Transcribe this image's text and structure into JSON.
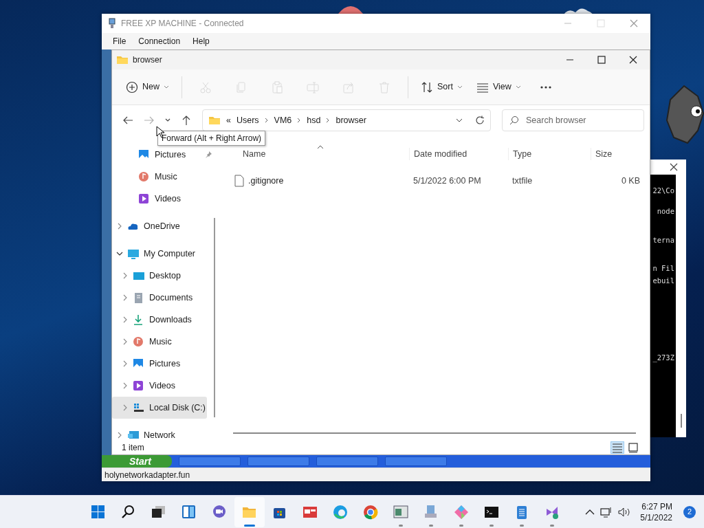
{
  "remote_window": {
    "title": "FREE XP MACHINE - Connected",
    "menu": [
      "File",
      "Connection",
      "Help"
    ],
    "status_bar": "holynetworkadapter.fun"
  },
  "xp_taskbar": {
    "start_label": "Start"
  },
  "host_console": {
    "lines": [
      "22\\Co",
      "node",
      "terna",
      "n Fil",
      "ebuil",
      "_273Z"
    ]
  },
  "explorer": {
    "title": "browser",
    "toolbar": [
      {
        "label": "New",
        "dropdown": true,
        "disabled": false
      },
      {
        "disabled": true
      },
      {
        "disabled": true
      },
      {
        "disabled": true
      },
      {
        "disabled": true
      },
      {
        "disabled": true
      },
      {
        "disabled": true
      },
      {
        "label": "Sort",
        "dropdown": true,
        "disabled": false
      },
      {
        "label": "View",
        "dropdown": true,
        "disabled": false
      },
      {
        "disabled": false
      }
    ],
    "navigation": [
      {
        "disabled": false
      },
      {
        "disabled": true
      },
      {
        "disabled": false
      },
      {
        "disabled": false
      }
    ],
    "address": {
      "overflow": "«",
      "breadcrumbs": [
        "Users",
        "VM6",
        "hsd",
        "browser"
      ]
    },
    "search": {
      "placeholder": "Search browser"
    },
    "tooltip": "Forward (Alt + Right Arrow)",
    "quick_access": [
      {
        "label": "Pictures",
        "pinned": true
      },
      {
        "label": "Music",
        "pinned": false
      },
      {
        "label": "Videos",
        "pinned": false
      }
    ],
    "tree": [
      {
        "label": "OneDrive",
        "expanded": false,
        "selected": false
      },
      {
        "label": "My Computer",
        "expanded": true,
        "selected": false,
        "children": [
          {
            "label": "Desktop",
            "expanded": false,
            "selected": false
          },
          {
            "label": "Documents",
            "expanded": false,
            "selected": false
          },
          {
            "label": "Downloads",
            "expanded": false,
            "selected": false
          },
          {
            "label": "Music",
            "expanded": false,
            "selected": false
          },
          {
            "label": "Pictures",
            "expanded": false,
            "selected": false
          },
          {
            "label": "Videos",
            "expanded": false,
            "selected": false
          },
          {
            "label": "Local Disk (C:)",
            "expanded": false,
            "selected": true
          }
        ]
      },
      {
        "label": "Network",
        "expanded": false,
        "selected": false
      }
    ],
    "columns": [
      {
        "label": "Name",
        "sorted": true
      },
      {
        "label": "Date modified",
        "sorted": false
      },
      {
        "label": "Type",
        "sorted": false
      },
      {
        "label": "Size",
        "sorted": false
      }
    ],
    "rows": [
      {
        "name": ".gitignore",
        "date_modified": "5/1/2022 6:00 PM",
        "type": "txtfile",
        "size": "0 KB"
      }
    ],
    "status": "1 item",
    "views": [
      {
        "selected": true
      },
      {
        "selected": false
      }
    ]
  },
  "taskbar": {
    "apps": [
      {
        "active": false,
        "running": false
      },
      {
        "active": false,
        "running": false
      },
      {
        "active": false,
        "running": false
      },
      {
        "active": false,
        "running": false
      },
      {
        "active": false,
        "running": false
      },
      {
        "active": true,
        "running": true
      },
      {
        "active": false,
        "running": false
      },
      {
        "active": false,
        "running": false
      },
      {
        "active": false,
        "running": false
      },
      {
        "active": false,
        "running": false
      },
      {
        "active": false,
        "running": true
      },
      {
        "active": false,
        "running": true
      },
      {
        "active": false,
        "running": true
      },
      {
        "active": false,
        "running": true
      },
      {
        "active": false,
        "running": true
      },
      {
        "active": false,
        "running": true
      }
    ],
    "time": "6:27 PM",
    "date": "5/1/2022",
    "notifications": "2"
  }
}
